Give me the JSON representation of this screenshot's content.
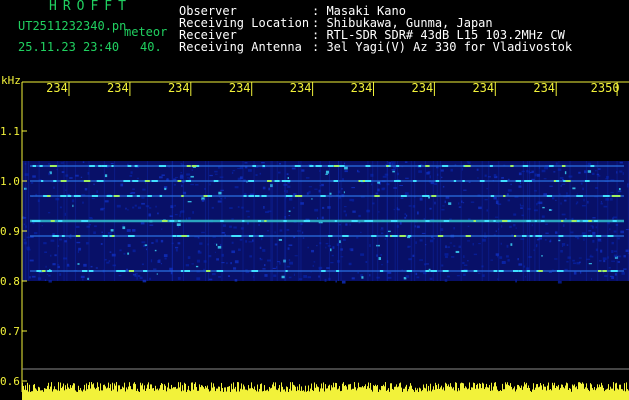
{
  "header": {
    "logo": "HROFFT",
    "filename": "UT2511232340.pn",
    "meteor_label": "meteor",
    "datetime": "25.11.23 23:40",
    "meteor_count": "40.",
    "fields": [
      {
        "label": "Observer",
        "value": ": Masaki Kano"
      },
      {
        "label": "Receiving Location",
        "value": ": Shibukawa, Gunma, Japan"
      },
      {
        "label": "Receiver",
        "value": ": RTL-SDR SDR# 43dB L15 103.2MHz CW"
      },
      {
        "label": "Receiving Antenna",
        "value": ": 3el Yagi(V) Az 330 for Vladivostok"
      }
    ]
  },
  "colors": {
    "header": "#20d060",
    "axis": "#f2f23a",
    "background": "#000000",
    "band": "#1030c0",
    "echo": "#40e0ff"
  },
  "chart_data": {
    "type": "heatmap",
    "ylabel": "kHz",
    "ylim": [
      0.6,
      1.2
    ],
    "y_ticks": [
      "1.1",
      "1.0",
      "0.9",
      "0.8",
      "0.7",
      "0.6"
    ],
    "x_ticks": [
      "234",
      "234",
      "234",
      "234",
      "234",
      "234",
      "234",
      "234",
      "234",
      "2350"
    ],
    "signal_band_khz": [
      0.8,
      1.04
    ],
    "strong_lines_khz": [
      0.92,
      0.97,
      1.0,
      1.03,
      0.82,
      0.89
    ]
  }
}
